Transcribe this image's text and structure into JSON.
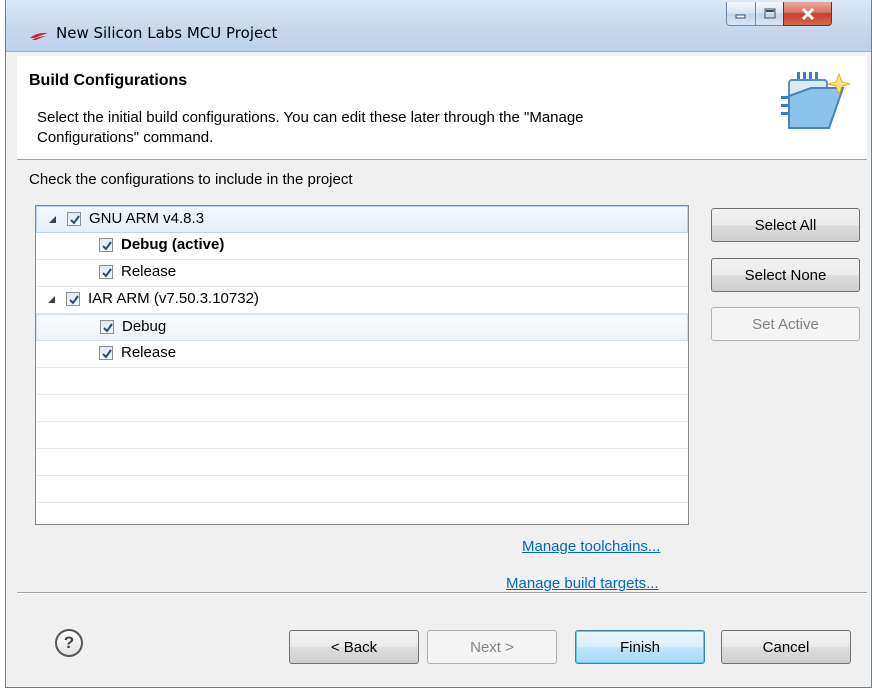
{
  "window": {
    "title": "New Silicon Labs MCU Project"
  },
  "banner": {
    "title": "Build Configurations",
    "description_line1": "Select the initial build configurations. You can edit these later through the \"Manage",
    "description_line2": "Configurations\" command."
  },
  "content": {
    "instruction": "Check the configurations to include in the project",
    "tree": [
      {
        "label": "GNU ARM v4.8.3",
        "checked": true,
        "expanded": true,
        "level": 0
      },
      {
        "label": "Debug (active)",
        "checked": true,
        "level": 1,
        "bold": true
      },
      {
        "label": "Release",
        "checked": true,
        "level": 1
      },
      {
        "label": "IAR ARM (v7.50.3.10732)",
        "checked": true,
        "expanded": true,
        "level": 0
      },
      {
        "label": "Debug",
        "checked": true,
        "level": 1
      },
      {
        "label": "Release",
        "checked": true,
        "level": 1
      }
    ],
    "buttons": {
      "select_all": "Select All",
      "select_none": "Select None",
      "set_active": "Set Active"
    },
    "links": {
      "manage_toolchains": "Manage toolchains...",
      "manage_build_targets": "Manage build targets..."
    }
  },
  "footer": {
    "help": "?",
    "back": "< Back",
    "next": "Next >",
    "finish": "Finish",
    "cancel": "Cancel"
  },
  "colors": {
    "link": "#0066cc",
    "window_bg": "#f0f0f0",
    "titlebar": "#c6d8ec"
  }
}
